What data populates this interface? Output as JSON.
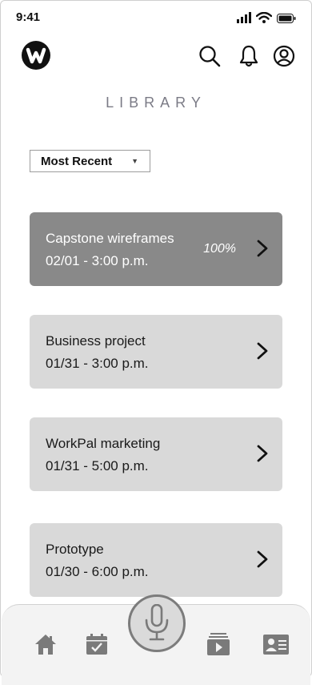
{
  "status_bar": {
    "time": "9:41"
  },
  "header": {
    "logo_icon": "workpal-logo-icon",
    "icons": [
      "search-icon",
      "bell-icon",
      "profile-icon"
    ]
  },
  "page": {
    "title": "LIBRARY"
  },
  "sort": {
    "selected": "Most Recent",
    "arrow": "▼"
  },
  "library": {
    "items": [
      {
        "title": "Capstone wireframes",
        "date": "02/01 - 3:00 p.m.",
        "progress": "100%",
        "active": true
      },
      {
        "title": "Business project",
        "date": "01/31 - 3:00 p.m.",
        "active": false
      },
      {
        "title": "WorkPal marketing",
        "date": "01/31 - 5:00 p.m.",
        "active": false
      },
      {
        "title": "Prototype",
        "date": "01/30 - 6:00 p.m.",
        "active": false
      }
    ]
  },
  "bottom_nav": {
    "items": [
      "home-icon",
      "calendar-icon",
      "microphone-icon",
      "video-library-icon",
      "contact-card-icon"
    ]
  },
  "colors": {
    "active_card": "#898989",
    "card": "#d9d9d9",
    "title": "#7b7b86",
    "icon": "#111111",
    "nav_icon": "#7a7a7a"
  }
}
